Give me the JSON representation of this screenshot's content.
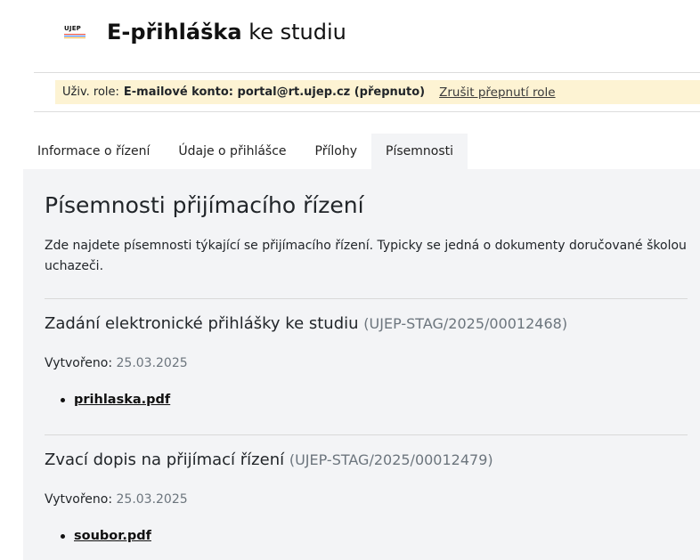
{
  "header": {
    "logo_text": "UJEP",
    "logo_stripe_colors": [
      "#e84b3c",
      "#3b6fd8",
      "#f3b23c"
    ],
    "title_bold": "E-přihláška",
    "title_rest": "ke studiu"
  },
  "role_bar": {
    "label": "Uživ. role:",
    "value": "E-mailové konto: portal@rt.ujep.cz (přepnuto)",
    "cancel_link": "Zrušit přepnutí role"
  },
  "tabs": [
    {
      "label": "Informace o řízení",
      "active": false
    },
    {
      "label": "Údaje o přihlášce",
      "active": false
    },
    {
      "label": "Přílohy",
      "active": false
    },
    {
      "label": "Písemnosti",
      "active": true
    }
  ],
  "main": {
    "title": "Písemnosti přijímacího řízení",
    "intro": "Zde najdete písemnosti týkající se přijímacího řízení. Typicky se jedná o dokumenty doručované školou uchazeči.",
    "documents": [
      {
        "title": "Zadání elektronické přihlášky ke studiu",
        "reference": "(UJEP-STAG/2025/00012468)",
        "created_label": "Vytvořeno:",
        "created_date": "25.03.2025",
        "file": "prihlaska.pdf"
      },
      {
        "title": "Zvací dopis na přijímací řízení",
        "reference": "(UJEP-STAG/2025/00012479)",
        "created_label": "Vytvořeno:",
        "created_date": "25.03.2025",
        "file": "soubor.pdf"
      }
    ]
  },
  "colors": {
    "role_bar_bg": "#fdf3d3",
    "content_bg": "#f3f4f6",
    "muted_text": "#6c757d"
  }
}
